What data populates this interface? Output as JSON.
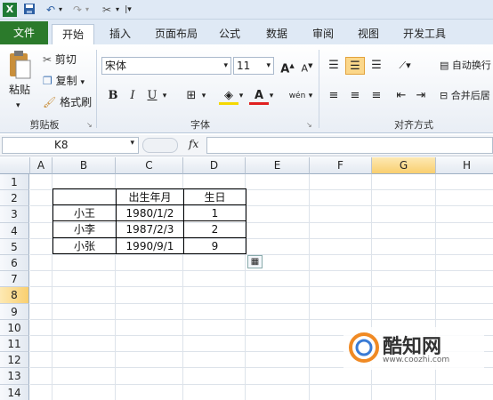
{
  "qat": {
    "icons": [
      "excel-logo-icon",
      "save-icon",
      "undo-icon",
      "redo-icon",
      "customize-icon"
    ]
  },
  "tabs": {
    "file": "文件",
    "items": [
      "开始",
      "插入",
      "页面布局",
      "公式",
      "数据",
      "审阅",
      "视图",
      "开发工具"
    ]
  },
  "ribbon": {
    "clipboard": {
      "paste": "粘贴",
      "cut": "剪切",
      "copy": "复制",
      "format_painter": "格式刷",
      "label": "剪贴板"
    },
    "font": {
      "name": "宋体",
      "size": "11",
      "bold": "B",
      "italic": "I",
      "underline": "U",
      "label": "字体",
      "wen": "wén"
    },
    "align": {
      "wrap": "自动换行",
      "merge": "合并后居",
      "label": "对齐方式"
    }
  },
  "formula_bar": {
    "name_box": "K8",
    "fx": "fx",
    "value": ""
  },
  "grid": {
    "columns": [
      "A",
      "B",
      "C",
      "D",
      "E",
      "F",
      "G",
      "H"
    ],
    "rows": [
      "1",
      "2",
      "3",
      "4",
      "5",
      "6",
      "7",
      "8",
      "9",
      "10",
      "11",
      "12",
      "13",
      "14"
    ],
    "selected_col": "G",
    "selected_row": "8",
    "table": {
      "header": [
        "",
        "出生年月",
        "生日"
      ],
      "rows": [
        [
          "小王",
          "1980/1/2",
          "1"
        ],
        [
          "小李",
          "1987/2/3",
          "2"
        ],
        [
          "小张",
          "1990/9/1",
          "9"
        ]
      ]
    }
  },
  "watermark": {
    "brand": "酷知网",
    "url": "www.coozhi.com"
  }
}
